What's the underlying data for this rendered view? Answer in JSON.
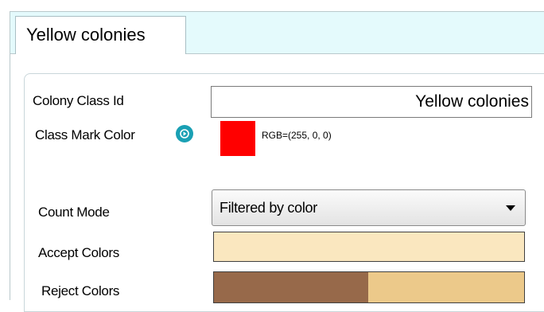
{
  "tab": {
    "label": "Yellow colonies"
  },
  "fields": {
    "colony_class_id": {
      "label": "Colony Class Id",
      "value": "Yellow colonies"
    },
    "class_mark_color": {
      "label": "Class Mark Color",
      "rgb_text": "RGB=(255, 0, 0)",
      "color": "#ff0000",
      "icon": "play-icon"
    },
    "count_mode": {
      "label": "Count Mode",
      "selected": "Filtered by color",
      "icon": "chevron-down-icon"
    },
    "accept_colors": {
      "label": "Accept Colors",
      "color": "#fae7bf"
    },
    "reject_colors": {
      "label": "Reject Colors",
      "colors": [
        "#97694a",
        "#ecc98a"
      ]
    }
  }
}
